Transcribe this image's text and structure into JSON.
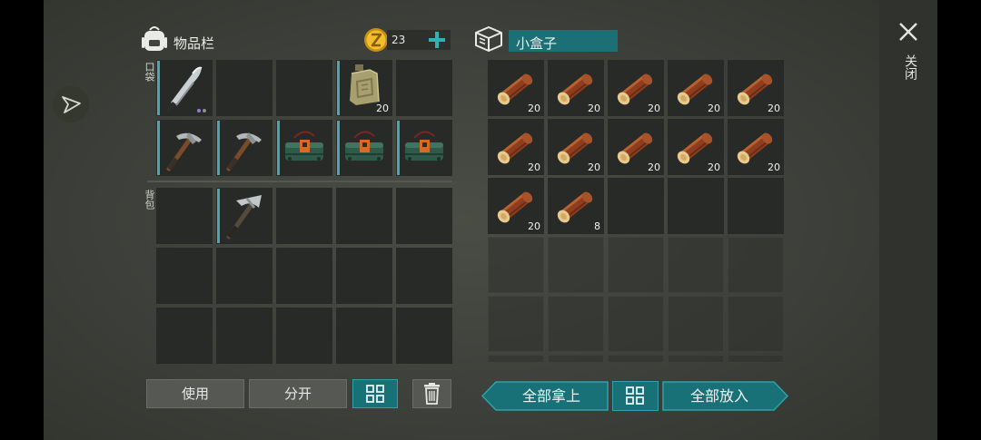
{
  "inventory": {
    "title": "物品栏",
    "coins": "23",
    "pocket_label": "口袋",
    "backpack_label": "背包",
    "pocket_slots": [
      {
        "item": "machete",
        "count": "",
        "dots": true
      },
      {
        "item": "",
        "count": ""
      },
      {
        "item": "",
        "count": ""
      },
      {
        "item": "jerrycan",
        "count": "20"
      },
      {
        "item": "",
        "count": ""
      },
      {
        "item": "pickaxe",
        "count": ""
      },
      {
        "item": "pickaxe",
        "count": ""
      },
      {
        "item": "dynamite-pack",
        "count": ""
      },
      {
        "item": "dynamite-pack",
        "count": ""
      },
      {
        "item": "dynamite-pack",
        "count": ""
      }
    ],
    "backpack_slots": [
      {
        "item": "",
        "count": ""
      },
      {
        "item": "pickaxe-dark",
        "count": ""
      },
      {
        "item": "",
        "count": ""
      },
      {
        "item": "",
        "count": ""
      },
      {
        "item": "",
        "count": ""
      }
    ]
  },
  "container": {
    "title": "小盒子",
    "slots": [
      {
        "item": "log",
        "count": "20"
      },
      {
        "item": "log",
        "count": "20"
      },
      {
        "item": "log",
        "count": "20"
      },
      {
        "item": "log",
        "count": "20"
      },
      {
        "item": "log",
        "count": "20"
      },
      {
        "item": "log",
        "count": "20"
      },
      {
        "item": "log",
        "count": "20"
      },
      {
        "item": "log",
        "count": "20"
      },
      {
        "item": "log",
        "count": "20"
      },
      {
        "item": "log",
        "count": "20"
      },
      {
        "item": "log",
        "count": "20"
      },
      {
        "item": "log",
        "count": "8"
      }
    ]
  },
  "buttons": {
    "use": "使用",
    "split": "分开",
    "take_all": "全部拿上",
    "put_all": "全部放入"
  },
  "close_label": "关闭",
  "icons": {
    "sort": "grid-sort-icon",
    "trash": "trash-icon",
    "backpack": "backpack-icon",
    "box": "box-icon",
    "coin": "coin-icon",
    "plus": "plus-icon",
    "close": "close-icon",
    "compass": "compass-icon"
  },
  "colors": {
    "accent": "#1a7278",
    "accent_light": "#2fa2a9",
    "coin": "#e7b21d"
  }
}
